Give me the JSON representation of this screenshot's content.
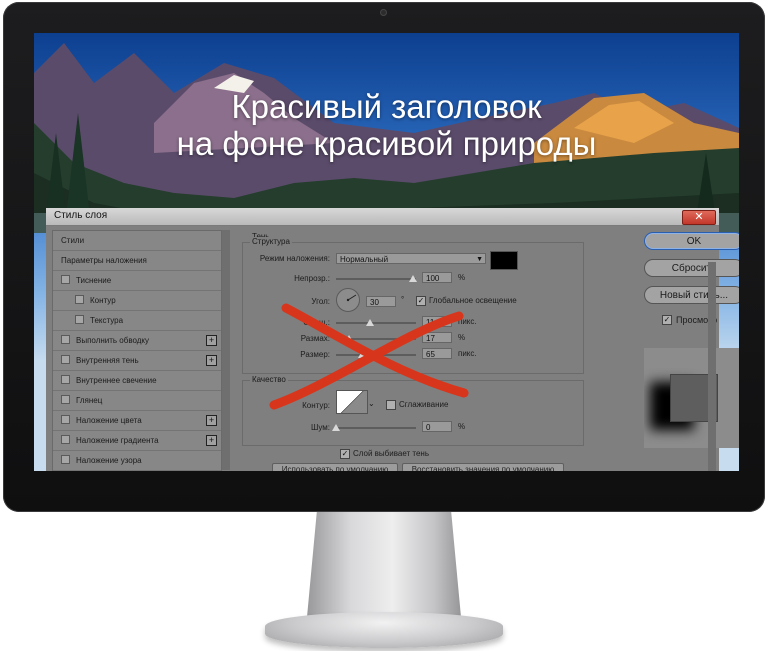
{
  "headline": {
    "line1": "Красивый заголовок",
    "line2": "на фоне красивой природы"
  },
  "dialog": {
    "title": "Стиль слоя",
    "close_label": "✕",
    "styles_list": [
      {
        "label": "Стили",
        "checkbox": false,
        "plus": false,
        "sub": false
      },
      {
        "label": "Параметры наложения",
        "checkbox": false,
        "plus": false,
        "sub": false
      },
      {
        "label": "Тиснение",
        "checkbox": true,
        "plus": false,
        "sub": false
      },
      {
        "label": "Контур",
        "checkbox": true,
        "plus": false,
        "sub": true
      },
      {
        "label": "Текстура",
        "checkbox": true,
        "plus": false,
        "sub": true
      },
      {
        "label": "Выполнить обводку",
        "checkbox": true,
        "plus": true,
        "sub": false
      },
      {
        "label": "Внутренняя тень",
        "checkbox": true,
        "plus": true,
        "sub": false
      },
      {
        "label": "Внутреннее свечение",
        "checkbox": true,
        "plus": false,
        "sub": false
      },
      {
        "label": "Глянец",
        "checkbox": true,
        "plus": false,
        "sub": false
      },
      {
        "label": "Наложение цвета",
        "checkbox": true,
        "plus": true,
        "sub": false
      },
      {
        "label": "Наложение градиента",
        "checkbox": true,
        "plus": true,
        "sub": false
      },
      {
        "label": "Наложение узора",
        "checkbox": true,
        "plus": false,
        "sub": false
      }
    ],
    "shadow": {
      "section_title": "Тень",
      "structure_title": "Структура",
      "blend_mode_label": "Режим наложения:",
      "blend_mode_value": "Нормальный",
      "shadow_color": "#000000",
      "opacity_label": "Непрозр.:",
      "opacity_value": "100",
      "opacity_unit": "%",
      "angle_label": "Угол:",
      "angle_value": "30",
      "angle_unit": "°",
      "global_light_label": "Глобальное освещение",
      "global_light_checked": true,
      "offset_label": "Смещ.:",
      "offset_value": "11",
      "offset_unit": "пикс.",
      "spread_label": "Размах:",
      "spread_value": "17",
      "spread_unit": "%",
      "size_label": "Размер:",
      "size_value": "65",
      "size_unit": "пикс.",
      "quality_title": "Качество",
      "contour_label": "Контур:",
      "antialias_label": "Сглаживание",
      "antialias_checked": false,
      "noise_label": "Шум:",
      "noise_value": "0",
      "noise_unit": "%",
      "knockout_label": "Слой выбивает тень",
      "knockout_checked": true,
      "default_button": "Использовать по умолчанию",
      "reset_default_button": "Восстановить значения по умолчанию"
    },
    "buttons": {
      "ok": "OK",
      "reset": "Сбросить",
      "new_style": "Новый стиль...",
      "preview_label": "Просмотр",
      "preview_checked": true
    }
  },
  "colors": {
    "strike_red": "#d8361c",
    "primary_outline": "#2a5fb0"
  }
}
